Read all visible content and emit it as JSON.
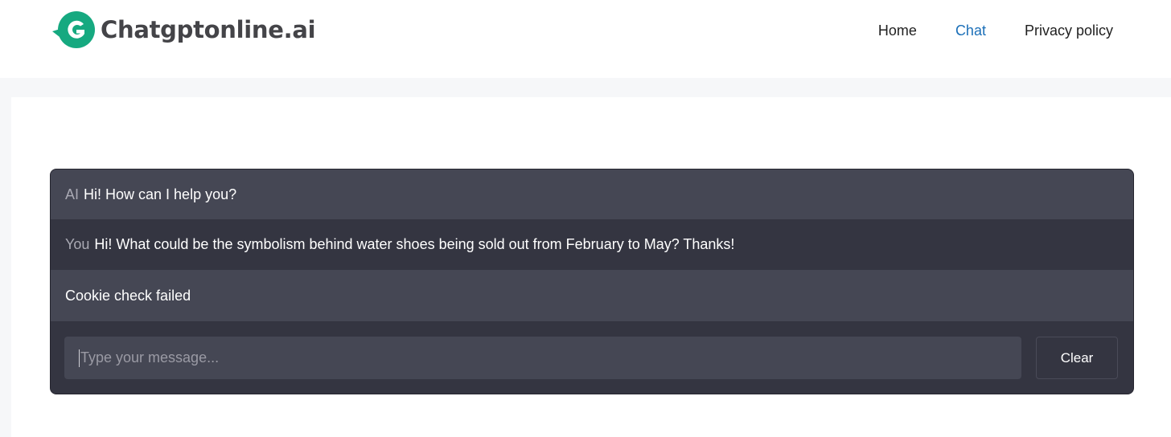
{
  "header": {
    "logo_text": "Chatgptonline.ai",
    "brand_color": "#16a980",
    "nav": [
      {
        "label": "Home",
        "active": false
      },
      {
        "label": "Chat",
        "active": true
      },
      {
        "label": "Privacy policy",
        "active": false
      }
    ],
    "active_color": "#1b6fb8"
  },
  "chat": {
    "messages": [
      {
        "sender": "AI",
        "text": "Hi! How can I help you?"
      },
      {
        "sender": "You",
        "text": "Hi! What could be the symbolism behind water shoes being sold out from February to May? Thanks!"
      },
      {
        "sender": "",
        "text": "Cookie check failed"
      }
    ],
    "input": {
      "placeholder": "Type your message...",
      "value": ""
    },
    "clear_label": "Clear"
  },
  "icons": {
    "logo": "g-logo-icon"
  }
}
